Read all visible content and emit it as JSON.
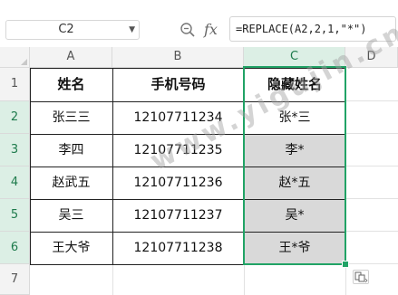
{
  "formula_bar": {
    "cell_ref": "C2",
    "zoom_icon": "zoom-icon",
    "fx_label": "fx",
    "formula": "=REPLACE(A2,2,1,\"*\")"
  },
  "columns": [
    "A",
    "B",
    "C",
    "D"
  ],
  "rows": [
    "1",
    "2",
    "3",
    "4",
    "5",
    "6",
    "7"
  ],
  "table": {
    "headers": [
      "姓名",
      "手机号码",
      "隐藏姓名"
    ],
    "rows": [
      [
        "张三三",
        "12107711234",
        "张*三"
      ],
      [
        "李四",
        "12107711235",
        "李*"
      ],
      [
        "赵武五",
        "12107711236",
        "赵*五"
      ],
      [
        "吴三",
        "12107711237",
        "吴*"
      ],
      [
        "王大爷",
        "12107711238",
        "王*爷"
      ]
    ]
  },
  "selection": {
    "active_column": "C",
    "range": "C2:C6",
    "accent_color": "#21a366"
  },
  "watermark": "www.yigujin.cn"
}
